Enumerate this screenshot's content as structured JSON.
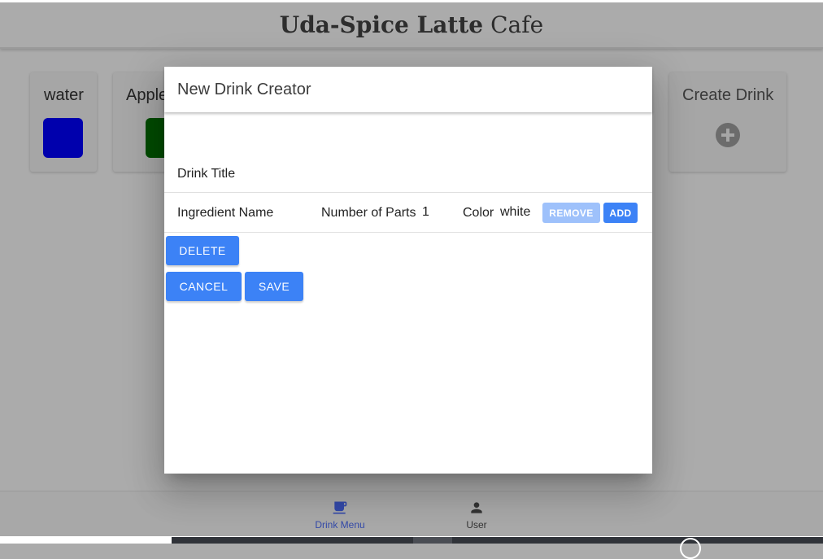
{
  "app": {
    "title_bold": "Uda-Spice Latte",
    "title_light": "Cafe"
  },
  "drink_cards": [
    {
      "title": "water",
      "swatch_color": "#0000cd"
    },
    {
      "title": "Apple",
      "swatch_color": "#006400"
    }
  ],
  "create_card": {
    "title": "Create Drink",
    "icon": "plus-circle-icon"
  },
  "dialog": {
    "title": "New Drink Creator",
    "drink_title_label": "Drink Title",
    "ingredient": {
      "name_label": "Ingredient Name",
      "parts_label": "Number of Parts",
      "parts_value": "1",
      "color_label": "Color",
      "color_value": "white",
      "remove_label": "REMOVE",
      "add_label": "ADD"
    },
    "delete_label": "DELETE",
    "cancel_label": "CANCEL",
    "save_label": "SAVE"
  },
  "bottom_nav": [
    {
      "label": "Drink Menu",
      "icon": "coffee-cup-icon",
      "active": true
    },
    {
      "label": "User",
      "icon": "person-icon",
      "active": false
    }
  ],
  "colors": {
    "accent": "#3c82f6",
    "accent_disabled": "#9ec1fb",
    "overlay_bg": "#ababab",
    "active_nav": "#3349a8"
  }
}
